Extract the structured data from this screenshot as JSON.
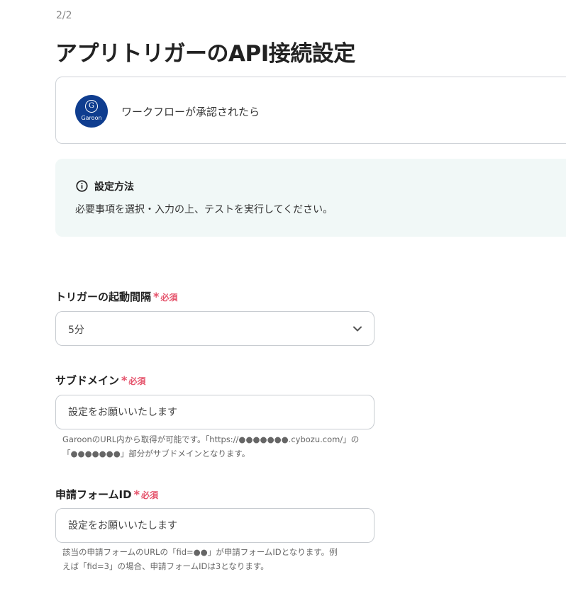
{
  "header": {
    "step": "2/2",
    "title": "アプリトリガーのAPI接続設定"
  },
  "app_card": {
    "logo_letter": "G",
    "logo_name": "Garoon",
    "event": "ワークフローが承認されたら"
  },
  "info": {
    "icon": "info-icon",
    "title": "設定方法",
    "text": "必要事項を選択・入力の上、テストを実行してください。"
  },
  "required": {
    "star": "*",
    "text": "必須"
  },
  "fields": {
    "interval": {
      "label": "トリガーの起動間隔",
      "value": "5分",
      "icon": "chevron-down-icon"
    },
    "subdomain": {
      "label": "サブドメイン",
      "placeholder": "設定をお願いいたします",
      "help_line1": "GaroonのURL内から取得が可能です。「https://●●●●●●●.cybozu.com/」の",
      "help_line2": "「●●●●●●●」部分がサブドメインとなります。"
    },
    "form_id": {
      "label": "申請フォームID",
      "placeholder": "設定をお願いいたします",
      "help_line1": "該当の申請フォームのURLの「fid=●●」が申請フォームIDとなります。例",
      "help_line2": "えば「fid=3」の場合、申請フォームIDは3となります。"
    }
  },
  "colors": {
    "accent_required": "#e5536b",
    "logo_bg": "#0f3d8f",
    "info_bg": "#f1f8f7"
  }
}
